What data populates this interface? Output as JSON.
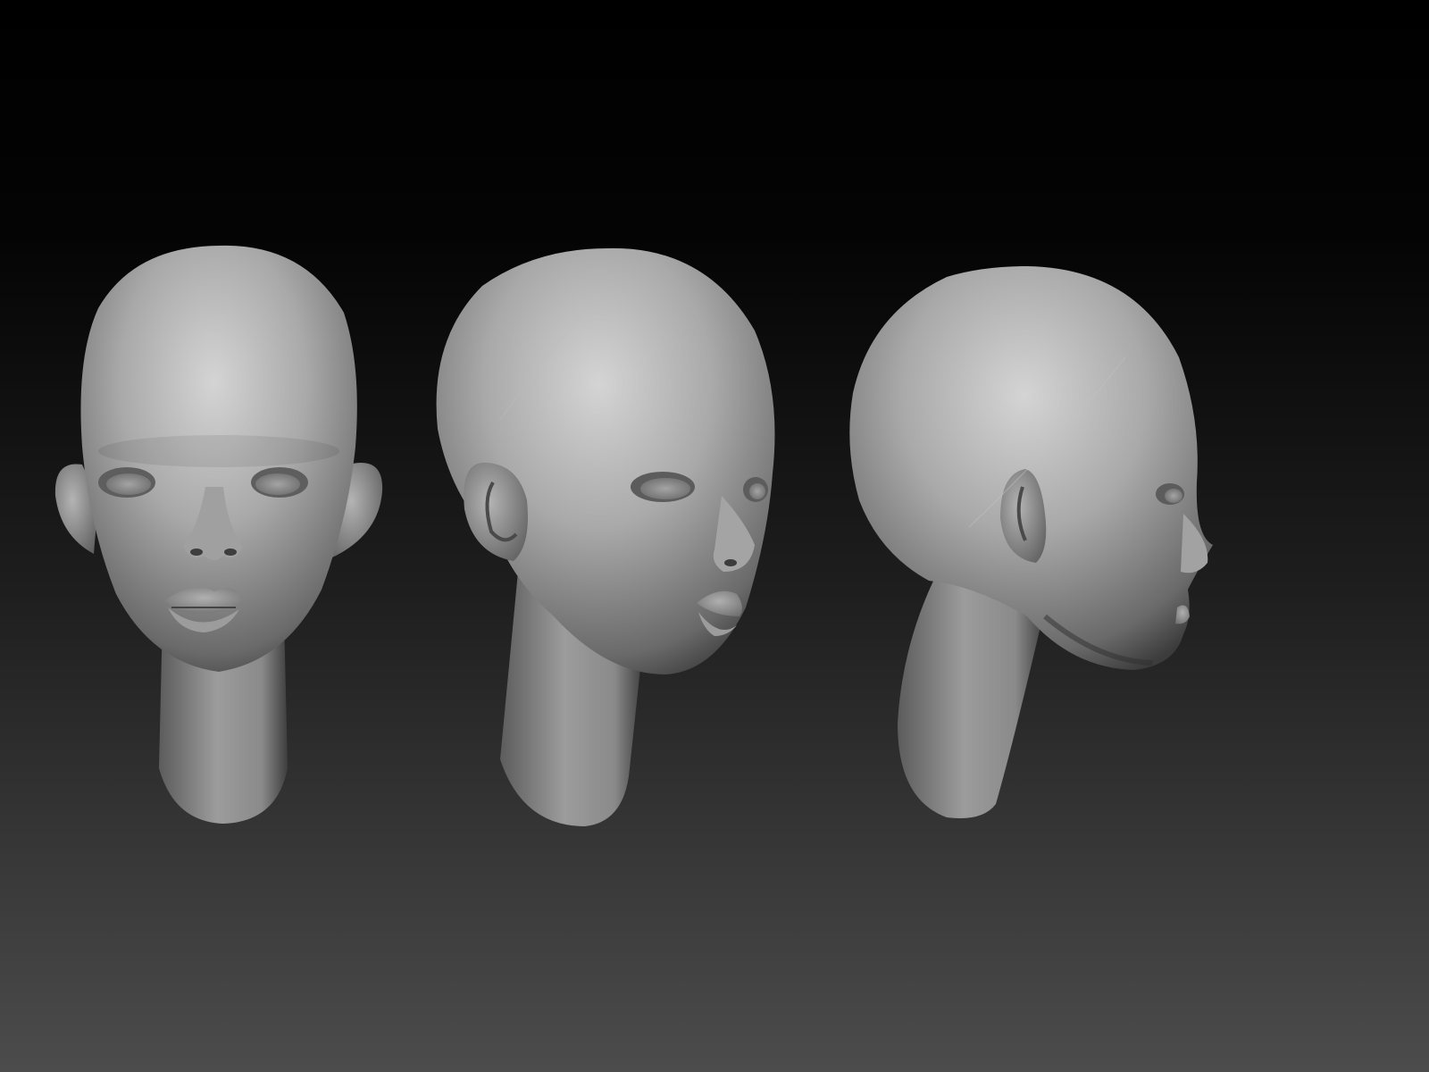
{
  "scene": {
    "colors": {
      "bg_top": "#000000",
      "bg_bottom": "#4c4c4c",
      "clay_light": "#d2d2d2",
      "clay_mid": "#8e8e8e",
      "clay_dark": "#3a3a3a"
    },
    "views": [
      {
        "name": "front-view"
      },
      {
        "name": "three-quarter-view"
      },
      {
        "name": "side-view"
      }
    ]
  }
}
